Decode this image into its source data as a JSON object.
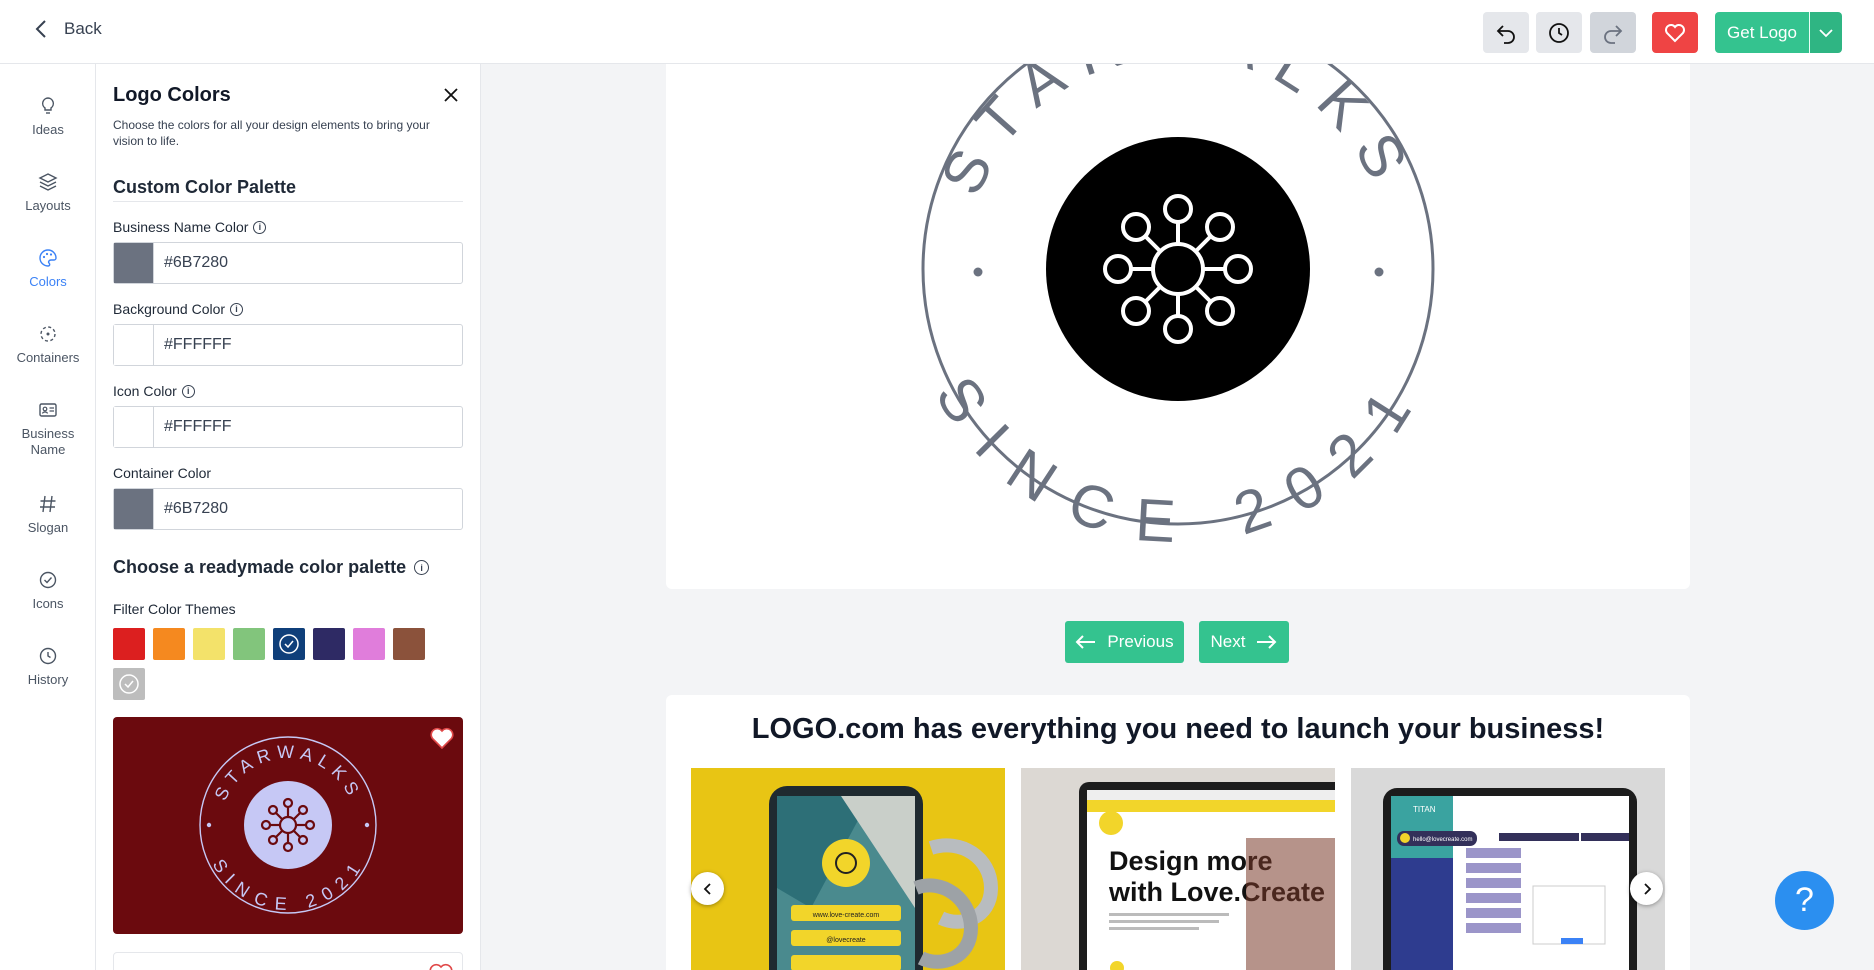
{
  "header": {
    "back_label": "Back",
    "get_logo_label": "Get Logo"
  },
  "rail": {
    "items": [
      {
        "label": "Ideas",
        "icon": "lightbulb-icon"
      },
      {
        "label": "Layouts",
        "icon": "layers-icon"
      },
      {
        "label": "Colors",
        "icon": "palette-icon",
        "active": true
      },
      {
        "label": "Containers",
        "icon": "containers-icon"
      },
      {
        "label": "Business Name",
        "icon": "id-card-icon"
      },
      {
        "label": "Slogan",
        "icon": "hash-icon"
      },
      {
        "label": "Icons",
        "icon": "check-circle-icon"
      },
      {
        "label": "History",
        "icon": "clock-icon"
      }
    ]
  },
  "panel": {
    "title": "Logo Colors",
    "description": "Choose the colors for all your design elements to bring your vision to life.",
    "custom_heading": "Custom Color Palette",
    "fields": {
      "business_name": {
        "label": "Business Name Color",
        "value": "#6B7280",
        "swatch": "#6B7280"
      },
      "background": {
        "label": "Background Color",
        "value": "#FFFFFF",
        "swatch": "#FFFFFF"
      },
      "icon": {
        "label": "Icon Color",
        "value": "#FFFFFF",
        "swatch": "#FFFFFF"
      },
      "container": {
        "label": "Container Color",
        "value": "#6B7280",
        "swatch": "#6B7280"
      }
    },
    "readymade_heading": "Choose a readymade color palette",
    "filter_label": "Filter Color Themes",
    "themes": [
      {
        "color": "#dc1f1f",
        "selected": false
      },
      {
        "color": "#f5891f",
        "selected": false
      },
      {
        "color": "#f3e26a",
        "selected": false
      },
      {
        "color": "#82c57c",
        "selected": false
      },
      {
        "color": "#0f3f7a",
        "selected": true
      },
      {
        "color": "#2e2a64",
        "selected": false
      },
      {
        "color": "#e07ddb",
        "selected": false
      },
      {
        "color": "#8b523b",
        "selected": false
      },
      {
        "color": "#bdbdbd",
        "selected": true
      }
    ],
    "palette_preview": {
      "background": "#6b0a0e",
      "accent": "#c6c8f5",
      "top_text": "STARWALKS",
      "bottom_text": "SINCE 2021"
    }
  },
  "logo": {
    "top_text": "STARWALKS",
    "bottom_text": "SINCE 2021",
    "ring_color": "#6B7280",
    "circle_color": "#000000",
    "icon_color": "#FFFFFF"
  },
  "nav": {
    "previous_label": "Previous",
    "next_label": "Next"
  },
  "promo": {
    "title": "LOGO.com has everything you need to launch your business!",
    "slide1": {
      "url": "www.love-create.com",
      "handle": "@lovecreate"
    },
    "slide2": {
      "headline_line1": "Design more",
      "headline_line2": "with Love.Create"
    },
    "slide3": {
      "brand": "TITAN",
      "email": "hello@lovecreate.com"
    }
  },
  "help_label": "?",
  "colors": {
    "accent_green": "#34c38f",
    "active_blue": "#3b82f6",
    "favorite_red": "#ef4444"
  }
}
